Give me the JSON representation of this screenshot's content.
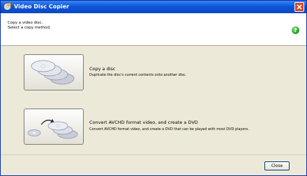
{
  "window": {
    "title": "Video Disc Copier"
  },
  "header": {
    "line1": "Copy a video disc.",
    "line2": "Select a copy method."
  },
  "options": [
    {
      "title": "Copy a disc",
      "description": "Duplicate the disc's current contents onto another disc."
    },
    {
      "title": "Convert AVCHD format video, and create a DVD",
      "description": "Convert AVCHD format video, and create a DVD that can be played with most DVD players."
    }
  ],
  "footer": {
    "close_label": "Close"
  },
  "icons": [
    "app-icon",
    "window-close-icon",
    "help-icon",
    "disc-stack-icon",
    "avchd-to-dvd-icon"
  ],
  "colors": {
    "titlebar": "#0a47c4",
    "help": "#1f9c22",
    "close": "#d9451d"
  }
}
